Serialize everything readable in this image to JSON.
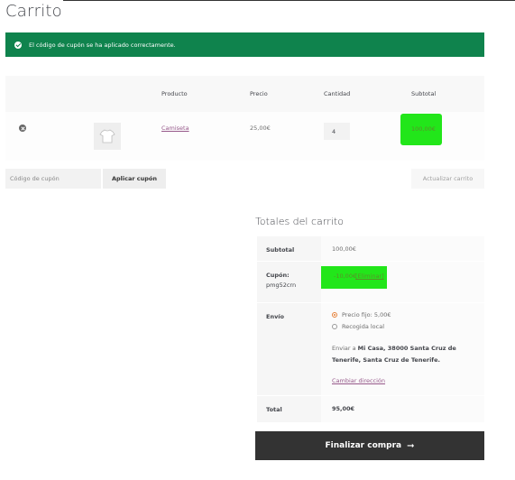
{
  "page": {
    "title": "Carrito"
  },
  "notice": {
    "text": "El código de cupón se ha aplicado correctamente."
  },
  "cart_table": {
    "headers": [
      "Producto",
      "Precio",
      "Cantidad",
      "Subtotal"
    ],
    "rows": [
      {
        "product": "Camiseta",
        "price": "25,00€",
        "quantity": "4",
        "subtotal": "100,00€"
      }
    ]
  },
  "coupon": {
    "placeholder": "Código de cupón",
    "apply_label": "Aplicar cupón",
    "update_label": "Actualizar carrito"
  },
  "totals": {
    "title": "Totales del carrito",
    "subtotal_label": "Subtotal",
    "subtotal_value": "100,00€",
    "coupon_label": "Cupón:",
    "coupon_code": "pmg52crn",
    "coupon_value": "-10,00€",
    "coupon_remove": "[Eliminar]",
    "shipping_label": "Envío",
    "shipping_options": [
      "Precio fijo: 5,00€",
      "Recogida local"
    ],
    "ship_to_prefix": "Enviar a",
    "ship_to_address": "Mi Casa, 38000 Santa Cruz de Tenerife, Santa Cruz de Tenerife.",
    "change_address": "Cambiar dirección",
    "total_label": "Total",
    "total_value": "95,00€"
  },
  "checkout": {
    "label": "Finalizar compra",
    "arrow": "➞"
  },
  "colors": {
    "notice_bg": "#0f834d",
    "highlight": "#22e61a",
    "link": "#96588a",
    "checkout_bg": "#333333"
  },
  "icons": {
    "notice": "check-circle-icon",
    "remove": "remove-circle-icon",
    "product": "tshirt-icon"
  }
}
